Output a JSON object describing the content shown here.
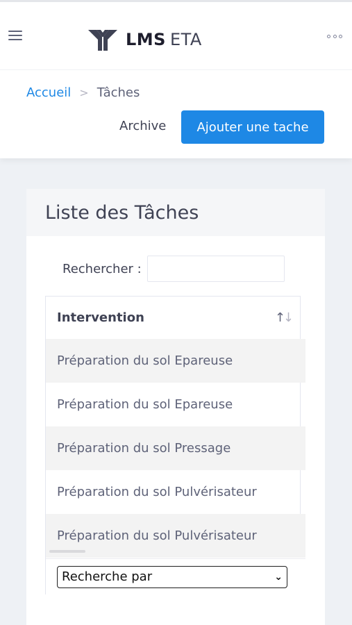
{
  "header": {
    "logo_primary": "LMS",
    "logo_secondary": "ETA"
  },
  "breadcrumb": {
    "home": "Accueil",
    "separator": ">",
    "current": "Tâches"
  },
  "actions": {
    "archive_label": "Archive",
    "add_label": "Ajouter une tache"
  },
  "card": {
    "title": "Liste des Tâches",
    "search_label": "Rechercher :",
    "search_value": "",
    "table": {
      "column_header": "Intervention",
      "sort_icon": "sort-icon",
      "rows": [
        "Préparation du sol Epareuse",
        "Préparation du sol Epareuse",
        "Préparation du sol Pressage",
        "Préparation du sol Pulvérisateur",
        "Préparation du sol Pulvérisateur"
      ]
    },
    "filter_select_value": "Recherche par"
  },
  "colors": {
    "accent": "#1e88e5",
    "text": "#3f4254",
    "page_bg": "#eef1f5",
    "row_alt": "#f3f3f3"
  }
}
